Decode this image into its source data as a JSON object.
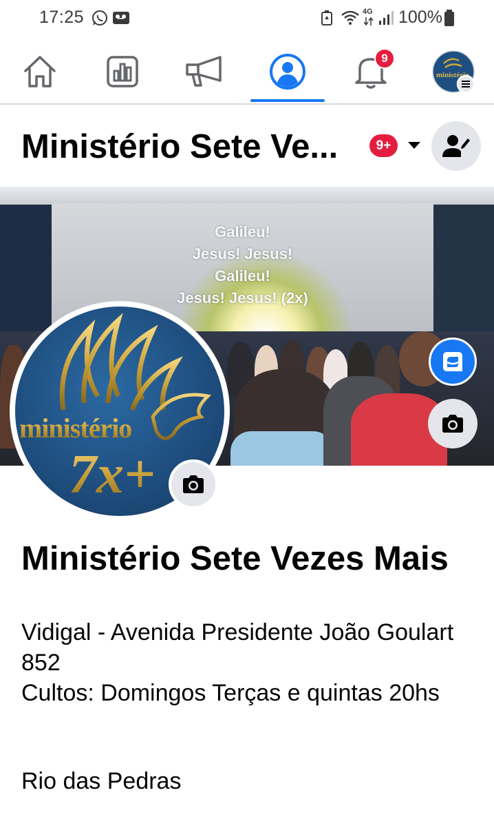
{
  "status_bar": {
    "time": "17:25",
    "battery": "100%",
    "network": "4G"
  },
  "nav": {
    "items": [
      "home",
      "insights",
      "announcements",
      "profile",
      "notifications",
      "menu"
    ],
    "active": "profile",
    "notifications_badge": "9",
    "accent_color": "#1877f2"
  },
  "header": {
    "title": "Ministério Sete Ve...",
    "badge": "9+"
  },
  "cover": {
    "lyrics": [
      "Galileu!",
      "Jesus! Jesus!",
      "Galileu!",
      "Jesus! Jesus! (2x)"
    ]
  },
  "profile": {
    "logo_text_1": "ministério",
    "logo_text_2": "7x+"
  },
  "page": {
    "name": "Ministério Sete Vezes Mais",
    "address_line": "Vidigal - Avenida Presidente João Goulart 852",
    "services_line": "Cultos: Domingos Terças e quintas 20hs",
    "location": "Rio das Pedras"
  }
}
